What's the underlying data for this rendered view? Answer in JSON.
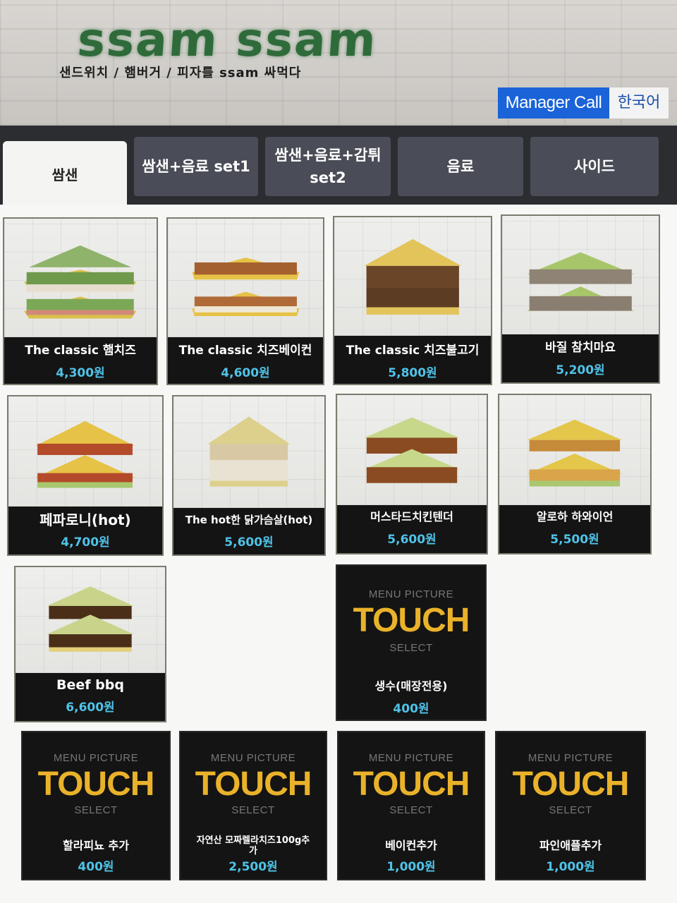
{
  "header": {
    "brand": "ssam ssam",
    "tagline": "샌드위치 / 햄버거 / 피자를 ssam 싸먹다",
    "manager_call": "Manager Call",
    "language": "한국어"
  },
  "tabs": [
    {
      "label": "쌈샌",
      "active": true
    },
    {
      "label": "쌈샌+음료 set1",
      "active": false
    },
    {
      "label": "쌈샌+음료+감튀 set2",
      "active": false
    },
    {
      "label": "음료",
      "active": false
    },
    {
      "label": "사이드",
      "active": false
    }
  ],
  "touch_placeholder": {
    "top": "MENU PICTURE",
    "big": "TOUCH",
    "bottom": "SELECT"
  },
  "menu": [
    {
      "name": "The classic 햄치즈",
      "price": "4,300원"
    },
    {
      "name": "The classic 치즈베이컨",
      "price": "4,600원"
    },
    {
      "name": "The classic 치즈불고기",
      "price": "5,800원"
    },
    {
      "name": "바질 참치마요",
      "price": "5,200원"
    },
    {
      "name": "페파로니(hot)",
      "price": "4,700원"
    },
    {
      "name": "The hot한 닭가슴살(hot)",
      "price": "5,600원"
    },
    {
      "name": "머스타드치킨텐더",
      "price": "5,600원"
    },
    {
      "name": "알로하 하와이언",
      "price": "5,500원"
    },
    {
      "name": "Beef bbq",
      "price": "6,600원"
    },
    {
      "name": "생수(매장전용)",
      "price": "400원"
    },
    {
      "name": "할라피뇨 추가",
      "price": "400원"
    },
    {
      "name": "자연산 모짜렐라치즈100g추가",
      "price": "2,500원"
    },
    {
      "name": "베이컨추가",
      "price": "1,000원"
    },
    {
      "name": "파인애플추가",
      "price": "1,000원"
    }
  ],
  "colors": {
    "manager_button": "#1a63d8",
    "price_text": "#4fc3e8",
    "touch_text": "#e9b22a",
    "brand_green": "#2f6b3a"
  }
}
